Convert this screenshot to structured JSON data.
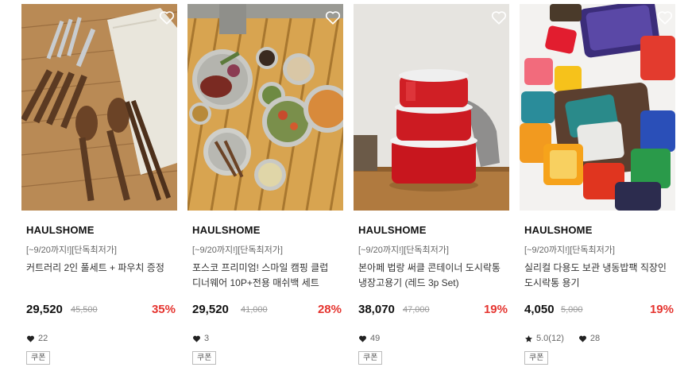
{
  "products": [
    {
      "brand": "HAULSHOME",
      "tag": "[~9/20까지!][단독최저가]",
      "title": "커트러리 2인 풀세트 + 파우치 증정",
      "price": "29,520",
      "original_price": "45,500",
      "discount": "35%",
      "likes": "22",
      "coupon": "쿠폰"
    },
    {
      "brand": "HAULSHOME",
      "tag": "[~9/20까지!][단독최저가]",
      "title": "포스코 프리미엄! 스마일 캠핑 클럽 디너웨어 10P+전용 매쉬백 세트",
      "price": "29,520",
      "original_price": "41,000",
      "discount": "28%",
      "likes": "3",
      "coupon": "쿠폰"
    },
    {
      "brand": "HAULSHOME",
      "tag": "[~9/20까지!][단독최저가]",
      "title": "본아페 법랑 써클 콘테이너 도시락통 냉장고용기 (레드 3p Set)",
      "price": "38,070",
      "original_price": "47,000",
      "discount": "19%",
      "likes": "49",
      "coupon": "쿠폰"
    },
    {
      "brand": "HAULSHOME",
      "tag": "[~9/20까지!][단독최저가]",
      "title": "실리컬 다용도 보관 냉동밥팩 직장인 도시락통 용기",
      "price": "4,050",
      "original_price": "5,000",
      "discount": "19%",
      "rating": "5.0(12)",
      "likes": "28",
      "coupon": "쿠폰"
    }
  ],
  "icons": {
    "wishlist": "heart-outline-icon",
    "likes": "heart-filled-icon",
    "rating": "star-filled-icon"
  },
  "colors": {
    "discount": "#e5342f",
    "brand_text": "#111111",
    "muted_text": "#999999"
  }
}
